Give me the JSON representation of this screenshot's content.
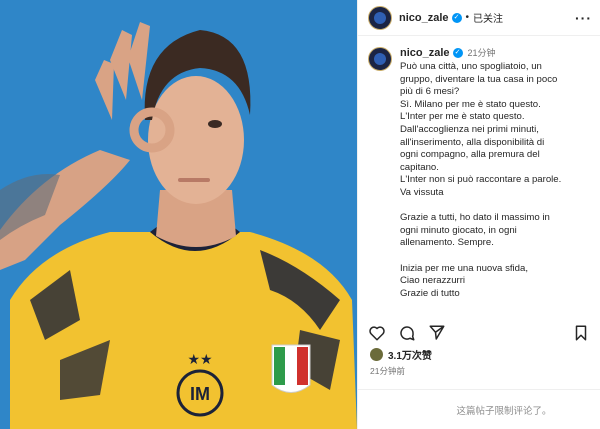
{
  "post": {
    "username": "nico_zale",
    "follow_state": "已关注",
    "time_ago": "21分钟",
    "caption_lines": [
      "Può una città, uno spogliatoio, un",
      "gruppo, diventare la tua casa in poco",
      "più di 6 mesi?",
      "Sì. Milano per me è stato questo.",
      "L'Inter per me è stato questo.",
      "Dall'accoglienza nei primi minuti,",
      "all'inserimento, alla disponibilità di",
      "ogni compagno, alla premura del",
      "capitano.",
      "L'Inter non si può raccontare a parole.",
      "Va vissuta",
      "",
      "Grazie a tutti, ho dato il massimo in",
      "ogni minuto giocato, in ogni",
      "allenamento. Sempre.",
      "",
      "Inizia per me una nuova sfida,",
      "Ciao nerazzurri",
      "Grazie di tutto"
    ],
    "likes": "3.1万次赞",
    "posted_time": "21分钟前",
    "comments_notice": "这篇帖子限制评论了。"
  },
  "icons": {
    "header_more": "more-horizontal-icon",
    "verified": "verified-badge-icon",
    "like": "heart-icon",
    "comment": "comment-icon",
    "share": "send-icon",
    "save": "bookmark-icon"
  },
  "colors": {
    "photo_background": "#2f86c8",
    "jersey": "#f2c230",
    "verified": "#0095f6"
  }
}
